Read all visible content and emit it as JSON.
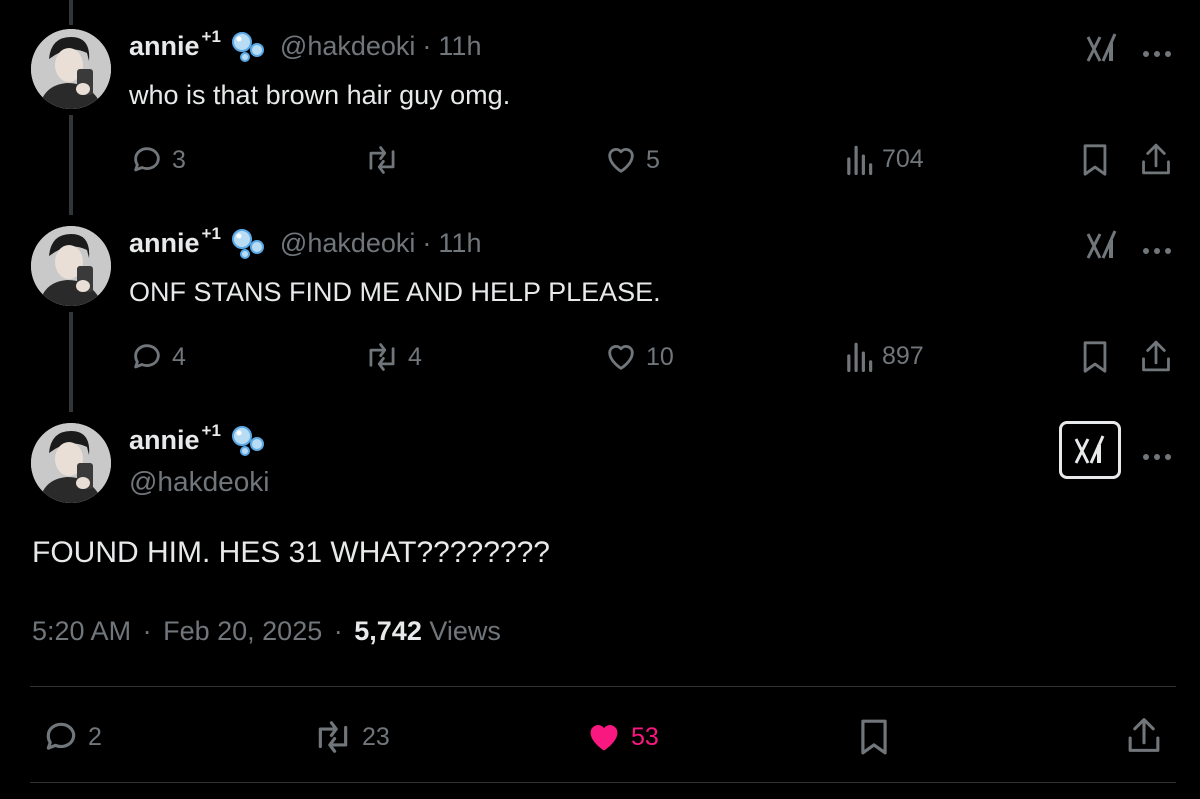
{
  "author": {
    "display_name": "annie",
    "superscript": "+1",
    "handle": "@hakdeoki"
  },
  "replies": [
    {
      "time": "11h",
      "text": "who is that brown hair guy omg.",
      "replies": "3",
      "reposts": "",
      "likes": "5",
      "views": "704"
    },
    {
      "time": "11h",
      "text": "ONF STANS FIND ME AND HELP PLEASE.",
      "replies": "4",
      "reposts": "4",
      "likes": "10",
      "views": "897"
    }
  ],
  "main_tweet": {
    "text": "FOUND HIM. HES 31 WHAT????????",
    "time": "5:20 AM",
    "date": "Feb 20, 2025",
    "views_count": "5,742",
    "views_label": "Views",
    "replies": "2",
    "reposts": "23",
    "likes": "53"
  },
  "separator": "·",
  "colors": {
    "background": "#000000",
    "text": "#e7e9ea",
    "muted": "#71767b",
    "like_active": "#f91880",
    "thread_line": "#333639"
  },
  "icons": [
    "bubble-emoji-icon",
    "grok-icon",
    "more-icon",
    "reply-icon",
    "repost-icon",
    "like-icon",
    "views-icon",
    "bookmark-icon",
    "share-icon"
  ]
}
